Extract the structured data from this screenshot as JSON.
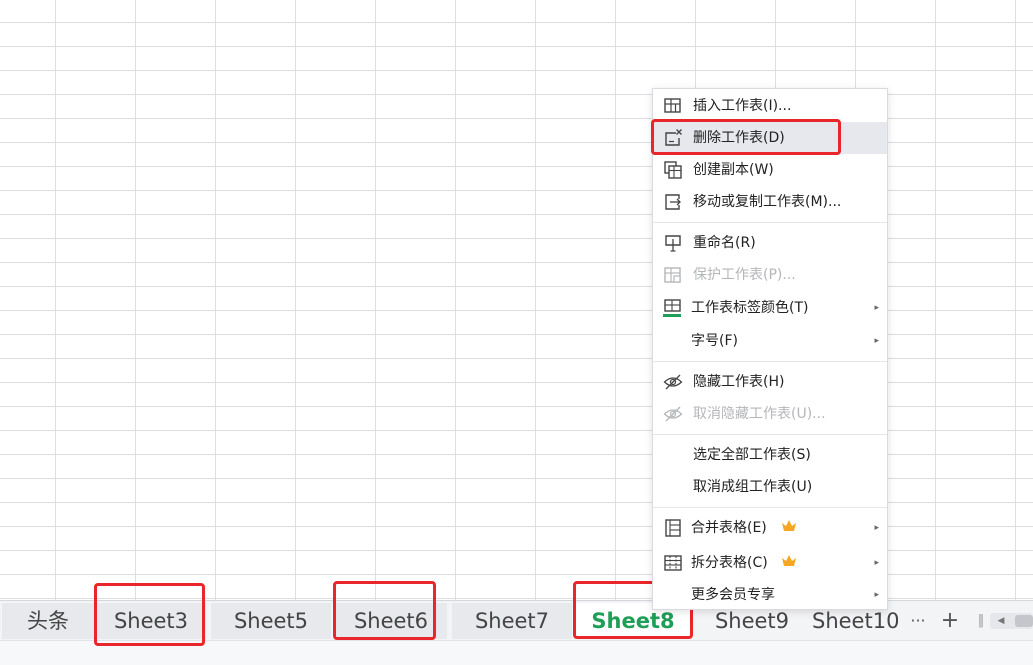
{
  "context_menu": {
    "items": [
      {
        "label": "插入工作表(I)..."
      },
      {
        "label": "删除工作表(D)"
      },
      {
        "label": "创建副本(W)"
      },
      {
        "label": "移动或复制工作表(M)..."
      },
      {
        "label": "重命名(R)"
      },
      {
        "label": "保护工作表(P)..."
      },
      {
        "label": "工作表标签颜色(T)"
      },
      {
        "label": "字号(F)"
      },
      {
        "label": "隐藏工作表(H)"
      },
      {
        "label": "取消隐藏工作表(U)..."
      },
      {
        "label": "选定全部工作表(S)"
      },
      {
        "label": "取消成组工作表(U)"
      },
      {
        "label": "合并表格(E)"
      },
      {
        "label": "拆分表格(C)"
      },
      {
        "label": "更多会员专享"
      }
    ],
    "submenu_arrow": "▸",
    "hovered_item": "删除工作表(D)",
    "tab_color_swatch": "#1f9e57",
    "premium_icon": "crown-icon"
  },
  "sheet_tabs": {
    "tabs": [
      "头条",
      "Sheet3",
      "Sheet5",
      "Sheet6",
      "Sheet7",
      "Sheet8",
      "Sheet9",
      "Sheet10"
    ],
    "active": "Sheet8",
    "more_label": "···",
    "add_label": "+"
  },
  "highlight_color": "#e8262b"
}
